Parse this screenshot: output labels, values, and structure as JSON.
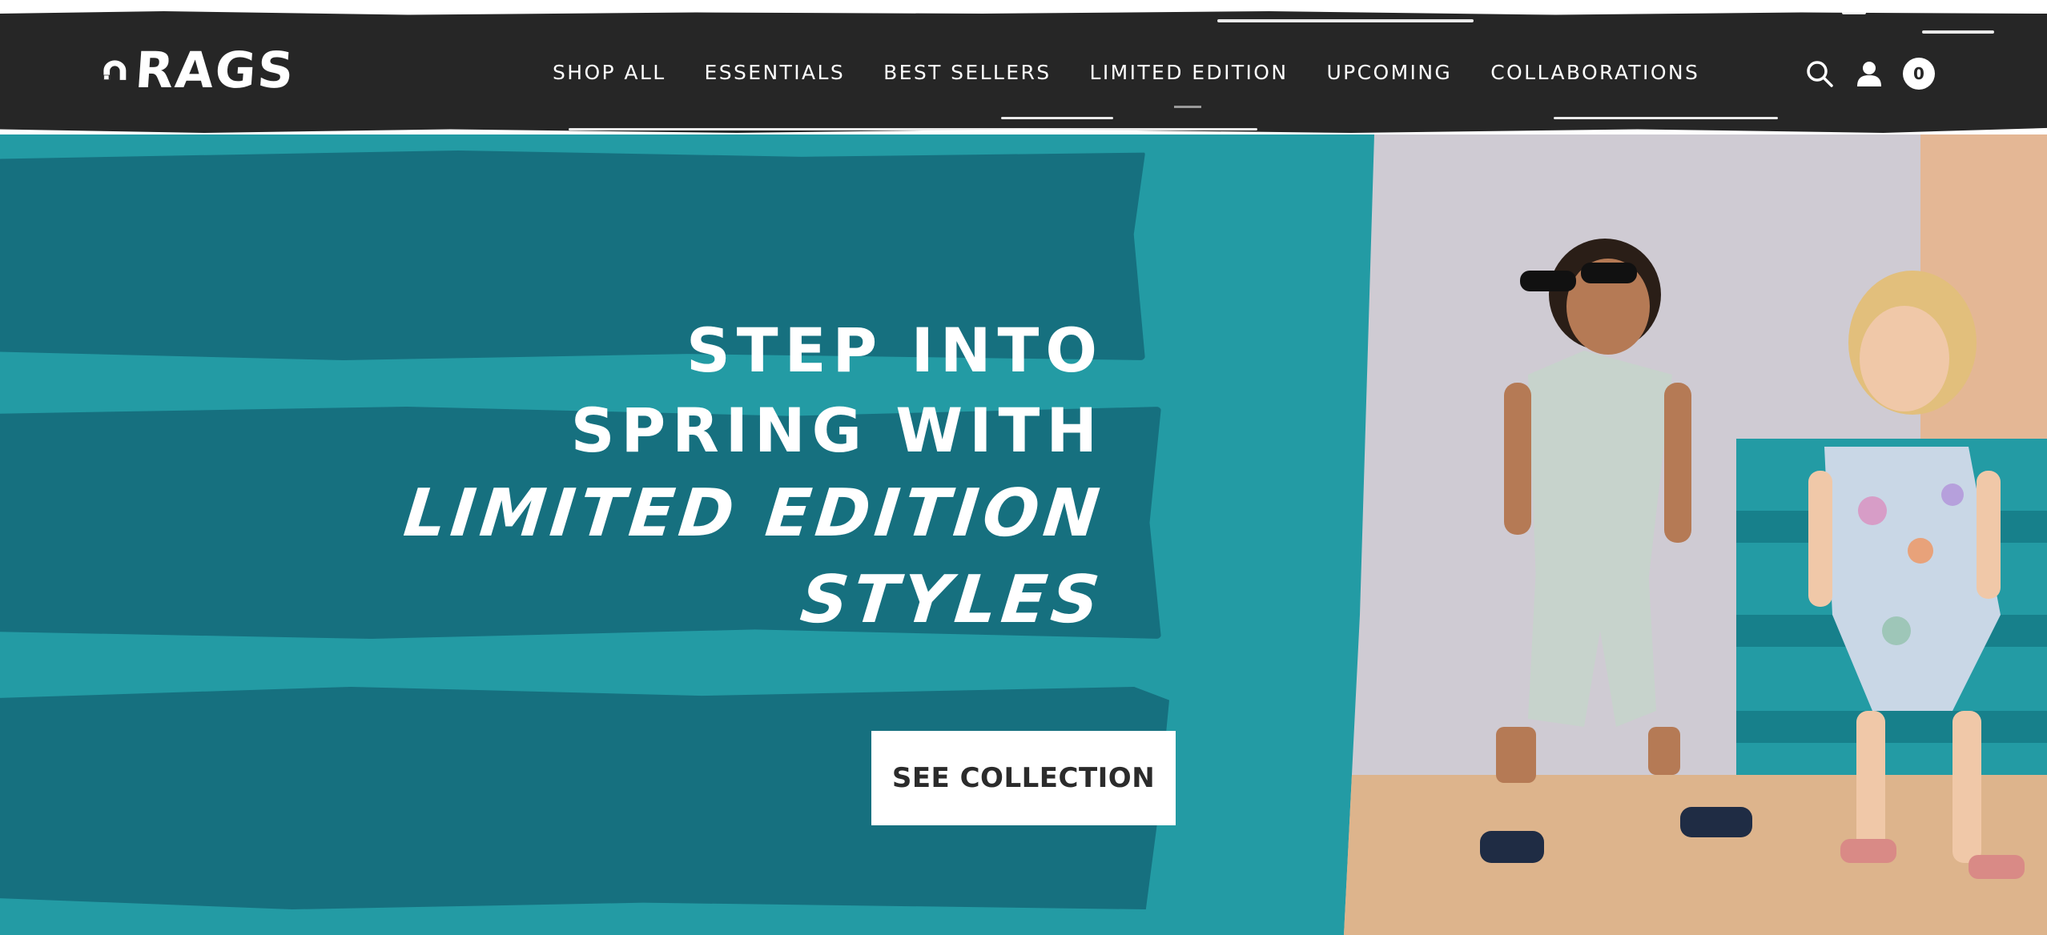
{
  "brand": {
    "name": "RAGS",
    "logo_icon": "rags-arch-logo-icon"
  },
  "nav": {
    "items": [
      {
        "label": "SHOP ALL"
      },
      {
        "label": "ESSENTIALS"
      },
      {
        "label": "BEST SELLERS"
      },
      {
        "label": "LIMITED EDITION"
      },
      {
        "label": "UPCOMING"
      },
      {
        "label": "COLLABORATIONS"
      }
    ]
  },
  "header_icons": {
    "search": "search-icon",
    "account": "user-icon",
    "cart_count": "0"
  },
  "hero": {
    "headline_line1": "STEP INTO",
    "headline_line2": "SPRING WITH",
    "headline_line3": "LIMITED EDITION",
    "headline_line4": "STYLES",
    "cta_label": "SEE COLLECTION",
    "image": "kids-in-spring-rompers-photo"
  },
  "colors": {
    "header_bg": "#262626",
    "hero_teal": "#239ba4",
    "hero_brush": "#16707f",
    "cta_bg": "#ffffff",
    "cta_text": "#2b2b2b"
  }
}
